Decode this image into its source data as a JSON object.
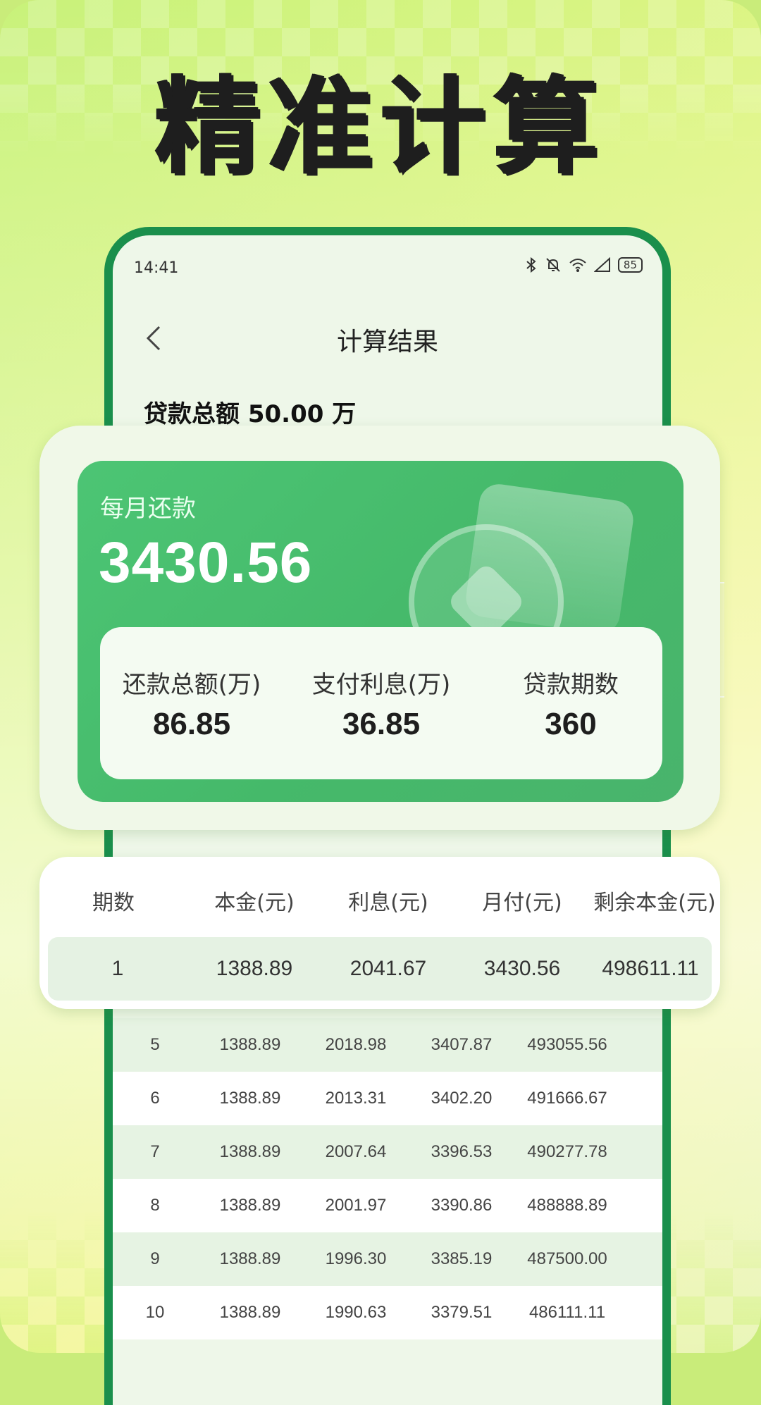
{
  "headline": "精准计算",
  "status": {
    "time": "14:41",
    "battery": "85"
  },
  "nav": {
    "title": "计算结果"
  },
  "loan_total": "贷款总额 50.00 万",
  "summary": {
    "monthly_label": "每月还款",
    "monthly_value": "3430.56",
    "stats": [
      {
        "label": "还款总额(万)",
        "value": "86.85"
      },
      {
        "label": "支付利息(万)",
        "value": "36.85"
      },
      {
        "label": "贷款期数",
        "value": "360"
      }
    ]
  },
  "table": {
    "headers": [
      "期数",
      "本金(元)",
      "利息(元)",
      "月付(元)",
      "剩余本金(元)"
    ],
    "first_row": [
      "1",
      "1388.89",
      "2041.67",
      "3430.56",
      "498611.11"
    ],
    "rows": [
      [
        "5",
        "1388.89",
        "2018.98",
        "3407.87",
        "493055.56"
      ],
      [
        "6",
        "1388.89",
        "2013.31",
        "3402.20",
        "491666.67"
      ],
      [
        "7",
        "1388.89",
        "2007.64",
        "3396.53",
        "490277.78"
      ],
      [
        "8",
        "1388.89",
        "2001.97",
        "3390.86",
        "488888.89"
      ],
      [
        "9",
        "1388.89",
        "1996.30",
        "3385.19",
        "487500.00"
      ],
      [
        "10",
        "1388.89",
        "1990.63",
        "3379.51",
        "486111.11"
      ]
    ]
  },
  "colors": {
    "accent_green": "#4cc574",
    "phone_frame": "#1a8f4c",
    "row_tint": "#e6f3e3"
  }
}
